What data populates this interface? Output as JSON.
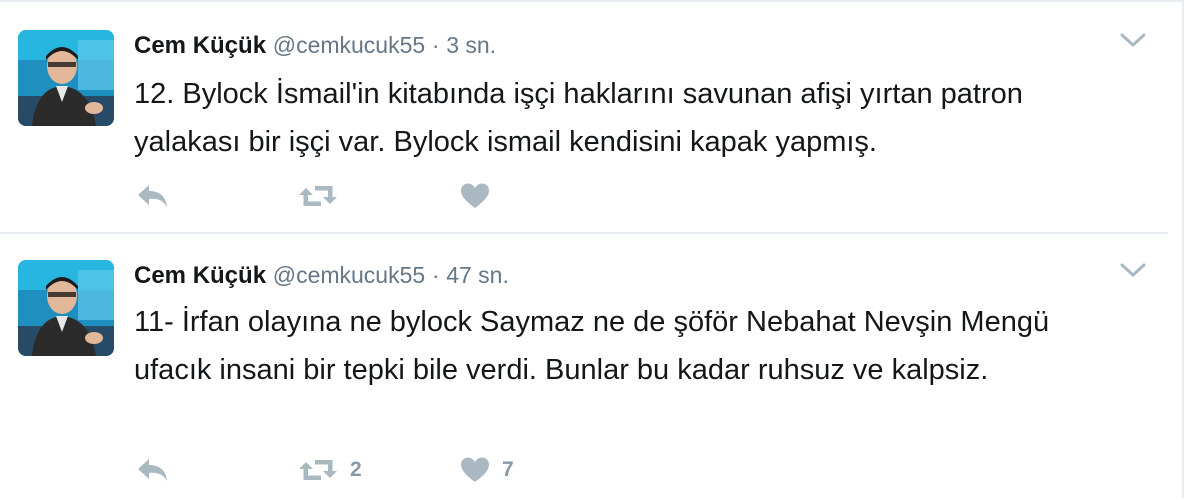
{
  "tweets": [
    {
      "author": {
        "name": "Cem Küçük",
        "handle": "@cemkucuk55"
      },
      "separator": "·",
      "time": "3 sn.",
      "text": "12. Bylock İsmail'in kitabında işçi haklarını savunan afişi yırtan patron yalakası bir işçi var. Bylock ismail kendisini kapak yapmış.",
      "retweets": "",
      "likes": ""
    },
    {
      "author": {
        "name": "Cem Küçük",
        "handle": "@cemkucuk55"
      },
      "separator": "·",
      "time": "47 sn.",
      "text": "11- İrfan olayına ne bylock Saymaz ne de şöför Nebahat Nevşin Mengü ufacık insani bir tepki bile verdi. Bunlar bu kadar ruhsuz ve kalpsiz.",
      "retweets": "2",
      "likes": "7"
    }
  ],
  "icons": {
    "reply": "reply-icon",
    "retweet": "retweet-icon",
    "like": "heart-icon",
    "more": "chevron-down-icon"
  },
  "colors": {
    "action_icon": "#aab8c2",
    "secondary_text": "#657786",
    "divider": "#e6ecf0"
  }
}
